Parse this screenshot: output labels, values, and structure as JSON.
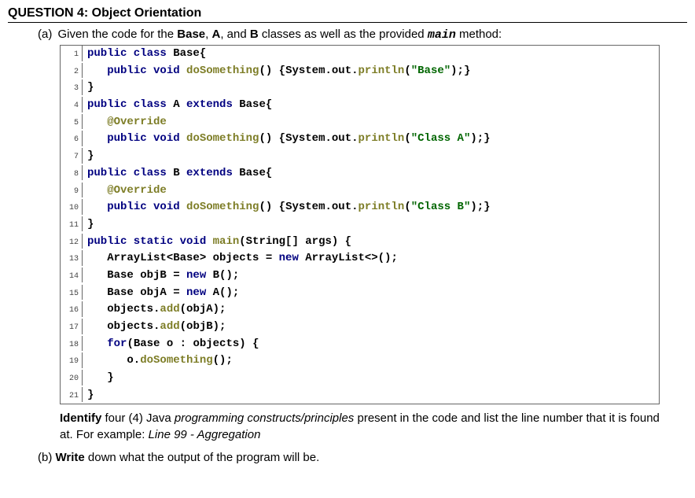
{
  "title": "QUESTION 4: Object Orientation",
  "partA": {
    "label": "(a)",
    "intro_before": "Given the code for the ",
    "base": "Base",
    "comma1": ", ",
    "a_class": "A",
    "comma2": ", and ",
    "b_class": "B",
    "intro_mid": " classes as well as the provided ",
    "main_word": "main",
    "intro_after": " method:"
  },
  "code": {
    "lines": [
      {
        "n": "1",
        "tokens": [
          [
            "kw",
            "public class "
          ],
          [
            "plain",
            "Base{"
          ]
        ]
      },
      {
        "n": "2",
        "tokens": [
          [
            "plain",
            "   "
          ],
          [
            "kw",
            "public void "
          ],
          [
            "fn",
            "doSomething"
          ],
          [
            "plain",
            "() {System."
          ],
          [
            "plain",
            "out"
          ],
          [
            "plain",
            "."
          ],
          [
            "fn",
            "println"
          ],
          [
            "plain",
            "("
          ],
          [
            "str",
            "\"Base\""
          ],
          [
            "plain",
            ");}"
          ]
        ]
      },
      {
        "n": "3",
        "tokens": [
          [
            "plain",
            "}"
          ]
        ]
      },
      {
        "n": "4",
        "tokens": [
          [
            "kw",
            "public class "
          ],
          [
            "plain",
            "A "
          ],
          [
            "kw",
            "extends "
          ],
          [
            "plain",
            "Base{"
          ]
        ]
      },
      {
        "n": "5",
        "tokens": [
          [
            "plain",
            "   "
          ],
          [
            "ann",
            "@Override"
          ]
        ]
      },
      {
        "n": "6",
        "tokens": [
          [
            "plain",
            "   "
          ],
          [
            "kw",
            "public void "
          ],
          [
            "fn",
            "doSomething"
          ],
          [
            "plain",
            "() {System."
          ],
          [
            "plain",
            "out"
          ],
          [
            "plain",
            "."
          ],
          [
            "fn",
            "println"
          ],
          [
            "plain",
            "("
          ],
          [
            "str",
            "\"Class A\""
          ],
          [
            "plain",
            ");}"
          ]
        ]
      },
      {
        "n": "7",
        "tokens": [
          [
            "plain",
            "}"
          ]
        ]
      },
      {
        "n": "8",
        "tokens": [
          [
            "kw",
            "public class "
          ],
          [
            "plain",
            "B "
          ],
          [
            "kw",
            "extends "
          ],
          [
            "plain",
            "Base{"
          ]
        ]
      },
      {
        "n": "9",
        "tokens": [
          [
            "plain",
            "   "
          ],
          [
            "ann",
            "@Override"
          ]
        ]
      },
      {
        "n": "10",
        "tokens": [
          [
            "plain",
            "   "
          ],
          [
            "kw",
            "public void "
          ],
          [
            "fn",
            "doSomething"
          ],
          [
            "plain",
            "() {System."
          ],
          [
            "plain",
            "out"
          ],
          [
            "plain",
            "."
          ],
          [
            "fn",
            "println"
          ],
          [
            "plain",
            "("
          ],
          [
            "str",
            "\"Class B\""
          ],
          [
            "plain",
            ");}"
          ]
        ]
      },
      {
        "n": "11",
        "tokens": [
          [
            "plain",
            "}"
          ]
        ]
      },
      {
        "n": "12",
        "tokens": [
          [
            "kw",
            "public static void "
          ],
          [
            "fn",
            "main"
          ],
          [
            "plain",
            "(String[] args) {"
          ]
        ]
      },
      {
        "n": "13",
        "tokens": [
          [
            "plain",
            "   ArrayList<Base> objects = "
          ],
          [
            "kw",
            "new "
          ],
          [
            "plain",
            "ArrayList<>();"
          ]
        ]
      },
      {
        "n": "14",
        "tokens": [
          [
            "plain",
            "   Base objB = "
          ],
          [
            "kw",
            "new "
          ],
          [
            "plain",
            "B();"
          ]
        ]
      },
      {
        "n": "15",
        "tokens": [
          [
            "plain",
            "   Base objA = "
          ],
          [
            "kw",
            "new "
          ],
          [
            "plain",
            "A();"
          ]
        ]
      },
      {
        "n": "16",
        "tokens": [
          [
            "plain",
            "   objects."
          ],
          [
            "fn",
            "add"
          ],
          [
            "plain",
            "(objA);"
          ]
        ]
      },
      {
        "n": "17",
        "tokens": [
          [
            "plain",
            "   objects."
          ],
          [
            "fn",
            "add"
          ],
          [
            "plain",
            "(objB);"
          ]
        ]
      },
      {
        "n": "18",
        "tokens": [
          [
            "plain",
            "   "
          ],
          [
            "kw",
            "for"
          ],
          [
            "plain",
            "(Base o : objects) {"
          ]
        ]
      },
      {
        "n": "19",
        "tokens": [
          [
            "plain",
            "      o."
          ],
          [
            "fn",
            "doSomething"
          ],
          [
            "plain",
            "();"
          ]
        ]
      },
      {
        "n": "20",
        "tokens": [
          [
            "plain",
            "   }"
          ]
        ]
      },
      {
        "n": "21",
        "tokens": [
          [
            "plain",
            "}"
          ]
        ]
      }
    ]
  },
  "instruction": {
    "identify": "Identify",
    "text1": " four (4) Java ",
    "constructs": "programming constructs/principles",
    "text2": " present in the code and list the line number that it is found at. For example: ",
    "example": "Line 99 - Aggregation"
  },
  "partB": {
    "label": "(b)",
    "write": "Write",
    "text": " down what the output of the program will be."
  }
}
